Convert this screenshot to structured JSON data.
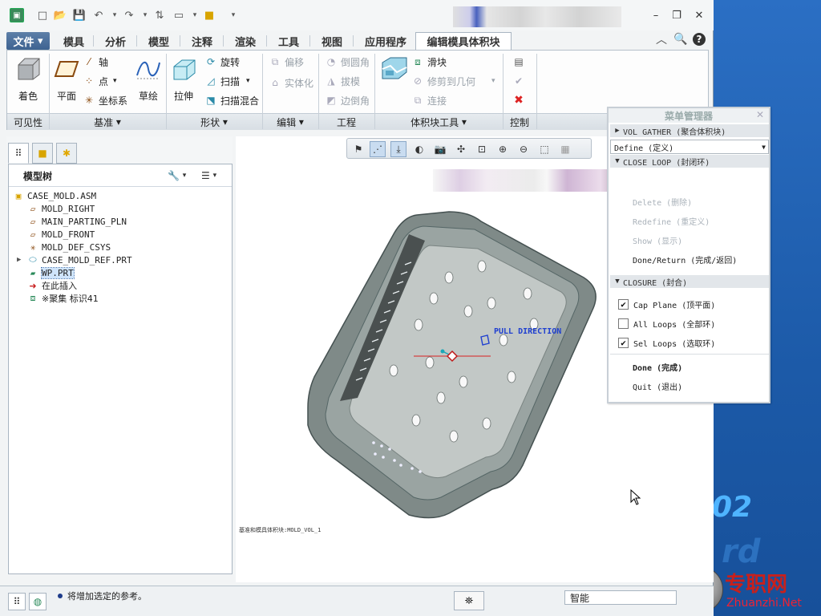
{
  "quick_access": {
    "icons": [
      "app-icon",
      "new-icon",
      "open-icon",
      "save-icon",
      "undo-icon",
      "redo-icon",
      "regenerate-icon",
      "windows-icon",
      "folder-icon",
      "customize-icon"
    ]
  },
  "ribbon_tabs": [
    {
      "label": "文件"
    },
    {
      "label": "模具"
    },
    {
      "label": "分析"
    },
    {
      "label": "模型"
    },
    {
      "label": "注释"
    },
    {
      "label": "渲染"
    },
    {
      "label": "工具"
    },
    {
      "label": "视图"
    },
    {
      "label": "应用程序"
    },
    {
      "label": "编辑模具体积块",
      "active": true
    }
  ],
  "ribbon": {
    "visibility": {
      "shade": "着色",
      "group": "可见性"
    },
    "datum": {
      "plane": "平面",
      "axis": "轴",
      "point": "点",
      "csys": "坐标系",
      "sketch": "草绘",
      "group": "基准"
    },
    "shapes": {
      "extrude": "拉伸",
      "revolve": "旋转",
      "sweep": "扫描",
      "swept_blend": "扫描混合",
      "group": "形状"
    },
    "editing": {
      "offset": "偏移",
      "solidify": "实体化",
      "group": "编辑"
    },
    "engineering": {
      "round": "倒圆角",
      "draft": "拔模",
      "chamfer": "边倒角",
      "group": "工程"
    },
    "volume_tools": {
      "slider": "滑块",
      "trim_to_geometry": "修剪到几何",
      "join": "连接",
      "group": "体积块工具"
    },
    "control": {
      "group": "控制"
    }
  },
  "model_tree": {
    "title": "模型树",
    "items": [
      {
        "label": "CASE_MOLD.ASM",
        "icon": "assembly-icon",
        "indent": 0
      },
      {
        "label": "MOLD_RIGHT",
        "icon": "datum-plane-icon",
        "indent": 1
      },
      {
        "label": "MAIN_PARTING_PLN",
        "icon": "datum-plane-icon",
        "indent": 1
      },
      {
        "label": "MOLD_FRONT",
        "icon": "datum-plane-icon",
        "indent": 1
      },
      {
        "label": "MOLD_DEF_CSYS",
        "icon": "csys-icon",
        "indent": 1
      },
      {
        "label": "CASE_MOLD_REF.PRT",
        "icon": "part-icon",
        "indent": 1,
        "expandable": true
      },
      {
        "label": "WP.PRT",
        "icon": "workpiece-icon",
        "indent": 1,
        "selected": true
      },
      {
        "label": "在此插入",
        "icon": "insert-arrow-icon",
        "indent": 1
      },
      {
        "label": "※聚集 标识41",
        "icon": "gather-icon",
        "indent": 1
      }
    ]
  },
  "graphics": {
    "pull_direction": "PULL DIRECTION",
    "status_text": "基准和模具体积块:MOLD_VOL_1"
  },
  "menu_manager": {
    "title": "菜单管理器",
    "vol_gather": "VOL GATHER (聚合体积块)",
    "define": "Define (定义)",
    "close_loop": "CLOSE LOOP (封闭环)",
    "close_loop_items": [
      {
        "label": "Delete (删除)",
        "disabled": true
      },
      {
        "label": "Redefine (重定义)",
        "disabled": true
      },
      {
        "label": "Show (显示)",
        "disabled": true
      },
      {
        "label": "Done/Return (完成/返回)",
        "disabled": false
      }
    ],
    "closure": "CLOSURE (封合)",
    "closure_items": [
      {
        "label": "Cap Plane (顶平面)",
        "checked": true
      },
      {
        "label": "All Loops (全部环)",
        "checked": false
      },
      {
        "label": "Sel Loops (选取环)",
        "checked": true
      }
    ],
    "done": "Done (完成)",
    "quit": "Quit (退出)"
  },
  "status_bar": {
    "message": "将增加选定的参考。",
    "filter": "智能"
  },
  "desktop": {
    "version_text": "02",
    "watermark_cn": "专职网",
    "watermark_url": "Zhuanzhi.Net"
  },
  "colors": {
    "accent": "#3e6391",
    "model_gray": "#7f8a88",
    "pull_direction": "#2040d0",
    "desktop_blue": "#1f5fb0"
  }
}
